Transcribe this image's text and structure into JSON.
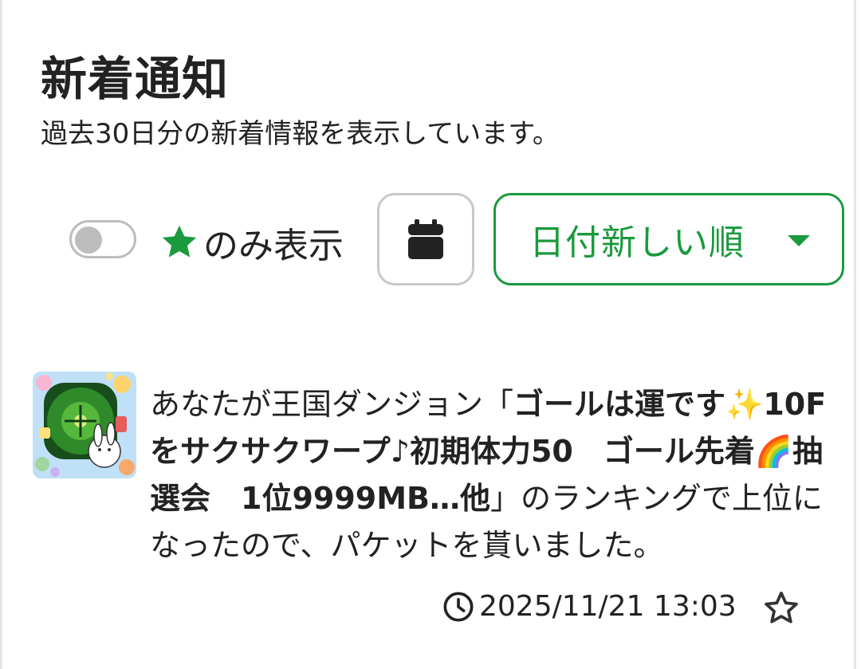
{
  "header": {
    "title": "新着通知",
    "subtitle": "過去30日分の新着情報を表示しています。"
  },
  "controls": {
    "star_only_label": "のみ表示",
    "star_only_enabled": false,
    "calendar_icon": "calendar-icon",
    "sort_label": "日付新しい順",
    "accent_color": "#1a9a3c"
  },
  "notification": {
    "thumbnail": "dungeon-banner-image",
    "text_pre": "あなたが王国ダンジョン",
    "text_quote_open": "「",
    "text_bold": "ゴールは運です✨10Fをサクサクワープ♪初期体力50　ゴール先着🌈抽選会　1位9999MB…他",
    "text_quote_close": "」",
    "text_post": "のランキングで上位になったので、パケットを貰いました。",
    "timestamp": "2025/11/21 13:03",
    "favorited": false
  }
}
